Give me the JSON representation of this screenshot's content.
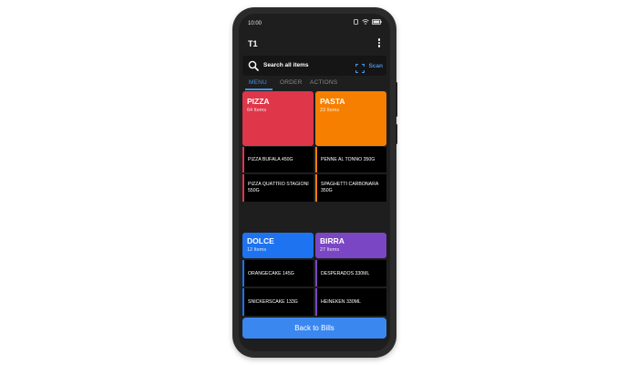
{
  "status": {
    "time": "10:00"
  },
  "app": {
    "title": "T1"
  },
  "search": {
    "placeholder": "Search all items",
    "scan_label": "Scan"
  },
  "tabs": [
    {
      "label": "MENU"
    },
    {
      "label": "ORDER"
    },
    {
      "label": "ACTIONS"
    }
  ],
  "categories": [
    {
      "name": "PIZZA",
      "count": "64 Items",
      "color": "#e0364a",
      "items": [
        {
          "label": "PIZZA BUFALA 450G"
        },
        {
          "label": "PIZZA QUATTRO STAGIONI 550G"
        }
      ]
    },
    {
      "name": "PASTA",
      "count": "23 Items",
      "color": "#f77f00",
      "items": [
        {
          "label": "PENNE AL TONNO 350G"
        },
        {
          "label": "SPAGHETTI CARBONARA 350G"
        }
      ]
    },
    {
      "name": "DOLCE",
      "count": "12 Items",
      "color": "#1e73f0",
      "items": [
        {
          "label": "ORANGECAKE 145G"
        },
        {
          "label": "SNICKERSCAKE 133G"
        }
      ]
    },
    {
      "name": "BIRRA",
      "count": "27 Items",
      "color": "#7b46c4",
      "items": [
        {
          "label": "DESPERADOS 330ML"
        },
        {
          "label": "HEINEKEN 330ML"
        }
      ]
    }
  ],
  "footer": {
    "back_label": "Back to Bills"
  },
  "accent": "#4a90e2"
}
